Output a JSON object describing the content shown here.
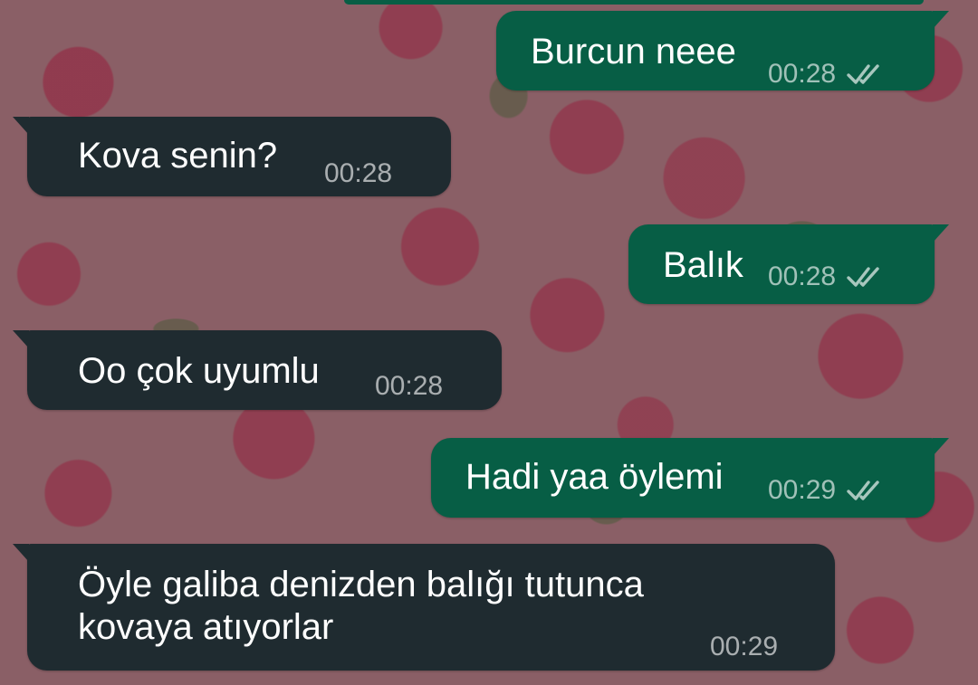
{
  "messages": [
    {
      "direction": "out",
      "text": "Burcun neee",
      "time": "00:28",
      "status_icon": "double-check-icon"
    },
    {
      "direction": "in",
      "text": "Kova senin?",
      "time": "00:28"
    },
    {
      "direction": "out",
      "text": "Balık",
      "time": "00:28",
      "status_icon": "double-check-icon"
    },
    {
      "direction": "in",
      "text": "Oo çok uyumlu",
      "time": "00:28"
    },
    {
      "direction": "out",
      "text": "Hadi yaa öylemi",
      "time": "00:29",
      "status_icon": "double-check-icon"
    },
    {
      "direction": "in",
      "text": "Öyle galiba denizden balığı tutunca\nkovaya atıyorlar",
      "time": "00:29"
    }
  ],
  "colors": {
    "outgoing_bubble": "#075e45",
    "incoming_bubble": "#1f2b30",
    "wallpaper": "#8a5f66"
  },
  "wallpaper_icon": "floral-wallpaper"
}
